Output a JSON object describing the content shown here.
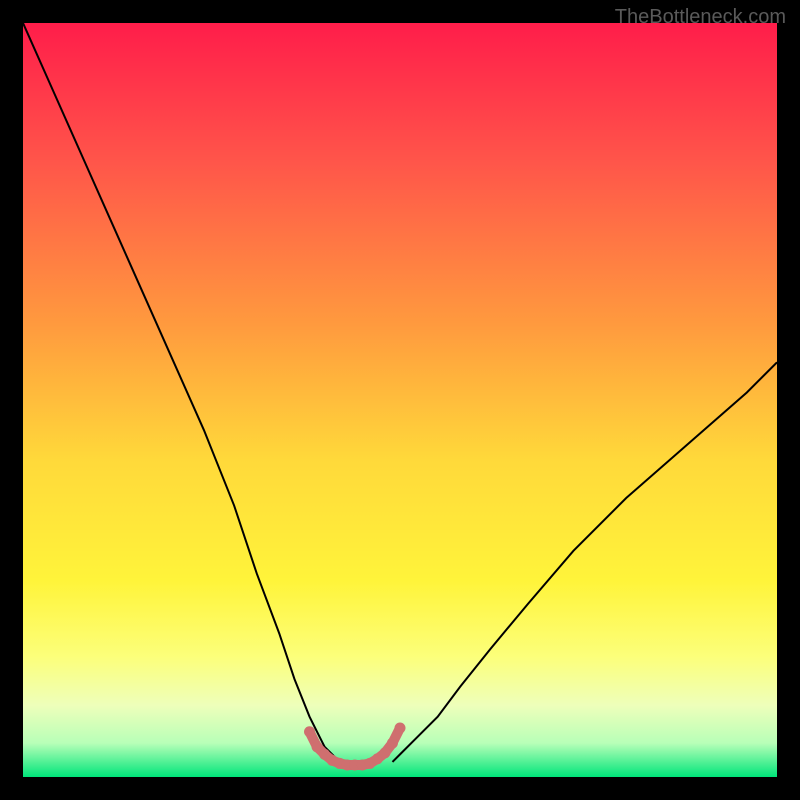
{
  "watermark": "TheBottleneck.com",
  "chart_data": {
    "type": "line",
    "title": "",
    "xlabel": "",
    "ylabel": "",
    "xlim": [
      0,
      100
    ],
    "ylim": [
      0,
      100
    ],
    "grid": false,
    "legend": false,
    "background_gradient": {
      "type": "vertical",
      "stops": [
        {
          "pos": 0.0,
          "color": "#ff1d4a"
        },
        {
          "pos": 0.18,
          "color": "#ff544a"
        },
        {
          "pos": 0.4,
          "color": "#ff9a3e"
        },
        {
          "pos": 0.58,
          "color": "#ffd93a"
        },
        {
          "pos": 0.74,
          "color": "#fff43a"
        },
        {
          "pos": 0.84,
          "color": "#fcff7a"
        },
        {
          "pos": 0.905,
          "color": "#eeffba"
        },
        {
          "pos": 0.955,
          "color": "#b8ffb8"
        },
        {
          "pos": 1.0,
          "color": "#00e57a"
        }
      ]
    },
    "series": [
      {
        "name": "left-curve",
        "color": "#000000",
        "width": 2,
        "x": [
          0,
          4,
          8,
          12,
          16,
          20,
          24,
          28,
          31,
          34,
          36,
          38,
          39,
          40,
          41,
          42
        ],
        "y": [
          100,
          91,
          82,
          73,
          64,
          55,
          46,
          36,
          27,
          19,
          13,
          8,
          6,
          4,
          3,
          2
        ]
      },
      {
        "name": "right-curve",
        "color": "#000000",
        "width": 2,
        "x": [
          49,
          50,
          52,
          55,
          58,
          62,
          67,
          73,
          80,
          88,
          96,
          100
        ],
        "y": [
          2,
          3,
          5,
          8,
          12,
          17,
          23,
          30,
          37,
          44,
          51,
          55
        ]
      },
      {
        "name": "bottom-bridge",
        "color": "#cf6f6f",
        "width": 10,
        "round": true,
        "x": [
          38,
          39,
          40,
          41,
          42,
          43,
          44,
          45,
          46,
          47,
          48,
          49,
          50
        ],
        "y": [
          6,
          4,
          3,
          2.2,
          1.8,
          1.6,
          1.6,
          1.6,
          1.8,
          2.4,
          3.2,
          4.5,
          6.5
        ]
      }
    ],
    "annotations": []
  }
}
